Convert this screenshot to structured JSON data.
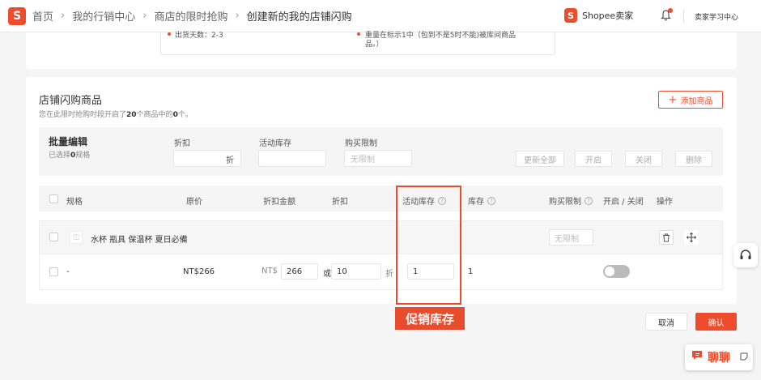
{
  "breadcrumb": [
    "首页",
    "我的行销中心",
    "商店的限时抢购",
    "创建新的我的店铺闪购"
  ],
  "header": {
    "brand": "Shopee卖家",
    "learning_center": "卖家学习中心"
  },
  "top_card": {
    "left_text": "出货天数：2-3",
    "right_text_1": "重量在标示1中（包到不是5时不能)被库间商品",
    "right_text_2": "品。）"
  },
  "section": {
    "title": "店铺闪购商品",
    "subtitle_pre": "您在此限时抢购时段开启了",
    "subtitle_count1": "20",
    "subtitle_mid": "个商品中的",
    "subtitle_count2": "0",
    "subtitle_post": "个。",
    "add_button": "添加商品"
  },
  "batch": {
    "title": "批量编辑",
    "selected_pre": "已选择",
    "selected_count": "0",
    "selected_post": "规格",
    "discount_label": "折扣",
    "discount_unit": "折",
    "stock_label": "活动库存",
    "limit_label": "购买限制",
    "limit_placeholder": "无限制",
    "update_all": "更新全部",
    "enable": "开启",
    "disable": "关闭",
    "delete": "删除"
  },
  "table": {
    "headers": {
      "spec": "规格",
      "orig_price": "原价",
      "discount_amount": "折扣金额",
      "discount": "折扣",
      "promo_stock": "活动库存",
      "stock": "库存",
      "purchase_limit": "购买限制",
      "toggle": "开启 / 关闭",
      "ops": "操作"
    },
    "product": {
      "name": "水杯 瓶具 保温杯 夏日必備",
      "limit_placeholder": "无限制"
    },
    "variant": {
      "spec": "-",
      "orig_price": "NT$266",
      "currency": "NT$",
      "discount_price": "266",
      "or": "或",
      "discount": "10",
      "discount_unit": "折",
      "promo_stock": "1",
      "stock": "1",
      "enabled": false
    }
  },
  "annotation": {
    "label": "促销库存",
    "color": "#e84c2d"
  },
  "footer": {
    "cancel": "取消",
    "confirm": "确认"
  },
  "chat": {
    "label": "聊聊"
  },
  "colors": {
    "brand": "#ee4d2d"
  }
}
